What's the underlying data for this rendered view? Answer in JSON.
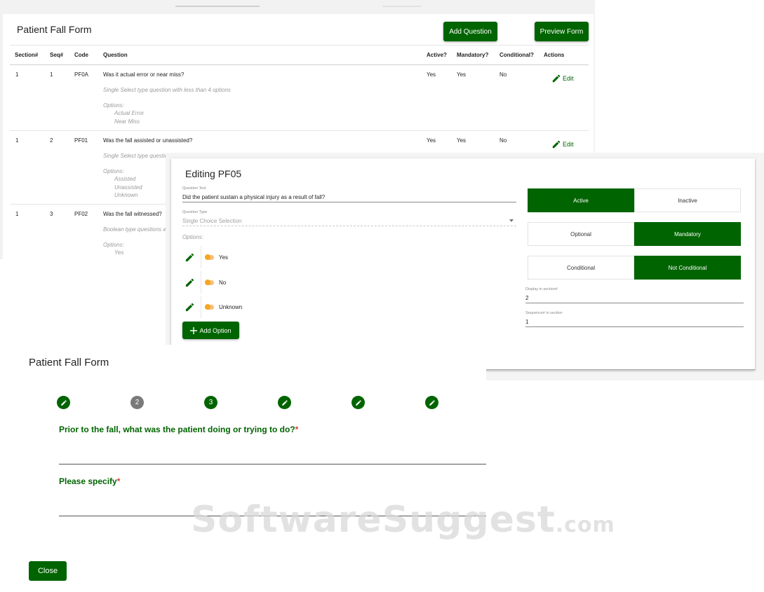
{
  "list": {
    "title": "Patient Fall Form",
    "add_question_label": "Add Question",
    "preview_form_label": "Preview Form",
    "columns": [
      "Section#",
      "Seq#",
      "Code",
      "Question",
      "Active?",
      "Mandatory?",
      "Conditional?",
      "Actions"
    ],
    "rows": [
      {
        "section": "1",
        "seq": "1",
        "code": "PF0A",
        "question": "Was it actual error or near miss?",
        "type_desc": "Single Select type question with less than 4 options",
        "options_label": "Options:",
        "options": [
          "Actual Error",
          "Near Miss"
        ],
        "active": "Yes",
        "mandatory": "Yes",
        "conditional": "No",
        "action": "Edit"
      },
      {
        "section": "1",
        "seq": "2",
        "code": "PF01",
        "question": "Was the fall assisted or unassisted?",
        "type_desc": "Single Select type questic",
        "options_label": "Options:",
        "options": [
          "Assisted",
          "Unassisted",
          "Unknown"
        ],
        "active": "Yes",
        "mandatory": "Yes",
        "conditional": "No",
        "action": "Edit"
      },
      {
        "section": "1",
        "seq": "3",
        "code": "PF02",
        "question": "Was the fall witnessed?",
        "type_desc": "Boolean type questions w",
        "options_label": "Options:",
        "options": [
          "Yes"
        ]
      }
    ]
  },
  "editor": {
    "title": "Editing PF05",
    "question_text_label": "Question Text",
    "question_text": "Did the patient sustain a physical injury as a result of fall?",
    "question_type_label": "Question Type",
    "question_type": "Single Choice Selection",
    "options_label": "Options:",
    "options": [
      "Yes",
      "No",
      "Unknown"
    ],
    "add_option_label": "Add Option",
    "active_label": "Active",
    "inactive_label": "Inactive",
    "optional_label": "Optional",
    "mandatory_label": "Mandatory",
    "conditional_label": "Conditional",
    "not_conditional_label": "Not Conditional",
    "selected": {
      "status": "Active",
      "requirement": "Mandatory",
      "condition": "Not Conditional"
    },
    "display_section_label": "Display in section#",
    "display_section": "2",
    "sequence_label": "Sequence# in section",
    "sequence": "1"
  },
  "preview": {
    "title": "Patient Fall Form",
    "steps": [
      {
        "type": "edit-icon"
      },
      {
        "type": "number",
        "label": "2",
        "color": "#7a7a7a"
      },
      {
        "type": "number",
        "label": "3",
        "color": "#006400"
      },
      {
        "type": "edit-icon"
      },
      {
        "type": "edit-icon"
      },
      {
        "type": "edit-icon"
      }
    ],
    "q1_label": "Prior to the fall, what was the patient doing or trying to do?",
    "q2_label": "Please specify",
    "required_mark": "*",
    "close_label": "Close"
  },
  "watermark": {
    "main": "SoftwareSuggest",
    "tld": ".com"
  },
  "colors": {
    "primary": "#006400",
    "required": "#e53935",
    "toggle": "#f5a623"
  }
}
